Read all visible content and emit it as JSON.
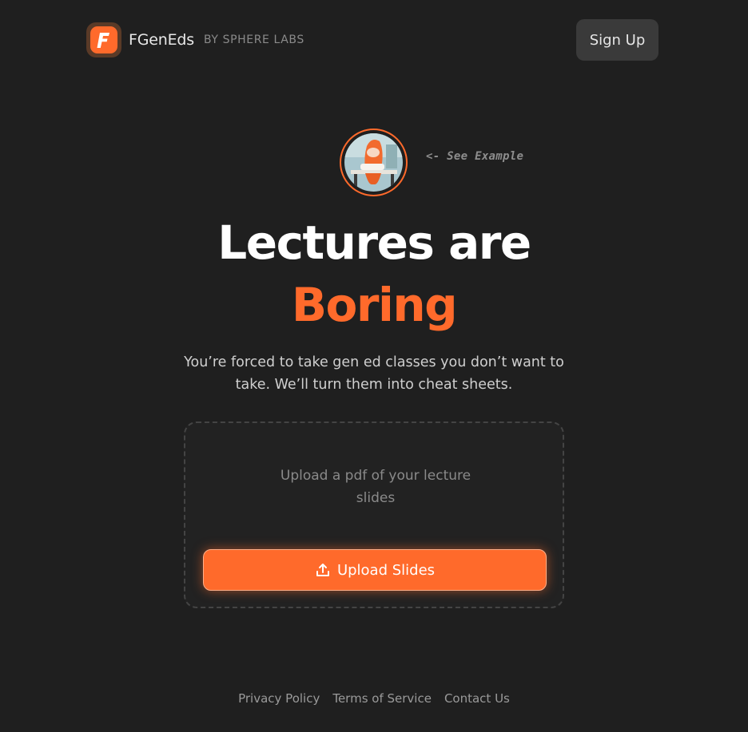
{
  "header": {
    "brand_name": "FGenEds",
    "brand_sub": "BY SPHERE LABS",
    "logo_letter": "F",
    "signup_label": "Sign Up"
  },
  "example": {
    "label": "<- See Example",
    "image_icon": "student-mascot-icon"
  },
  "hero": {
    "title": "Lectures are",
    "accent": "Boring",
    "subtitle": "You’re forced to take gen ed classes you don’t want to take. We’ll turn them into cheat sheets."
  },
  "upload": {
    "prompt": "Upload a pdf of your lecture slides",
    "button_label": "Upload Slides",
    "button_icon": "upload-icon"
  },
  "footer": {
    "links": [
      "Privacy Policy",
      "Terms of Service",
      "Contact Us"
    ]
  },
  "colors": {
    "background": "#1f1f1f",
    "accent": "#ff6a2b",
    "button_secondary": "#3a3a3a"
  }
}
